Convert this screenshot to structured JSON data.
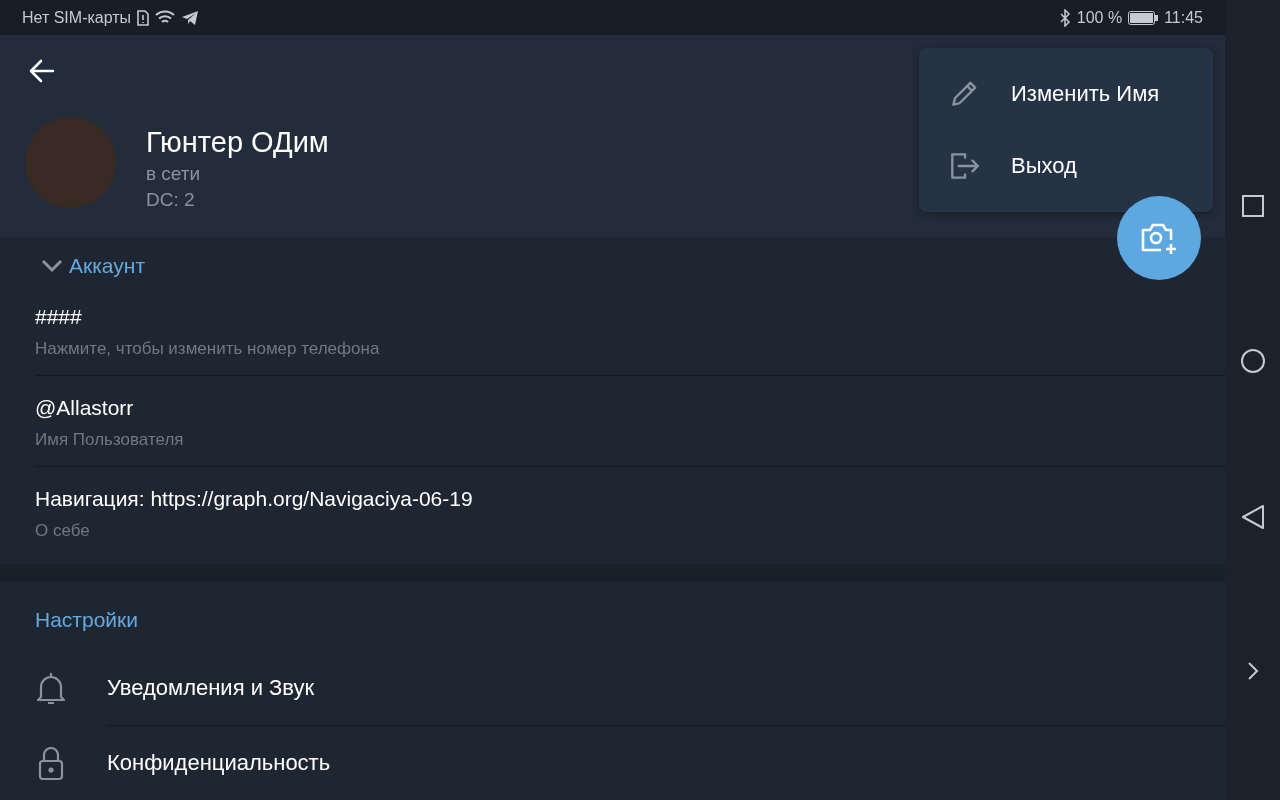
{
  "status_bar": {
    "carrier": "Нет SIM-карты",
    "battery": "100 %",
    "time": "11:45"
  },
  "profile": {
    "name": "Гюнтер ОДим",
    "status": "в сети",
    "dc": "DC: 2"
  },
  "menu": [
    {
      "kind": "edit",
      "label": "Изменить Имя"
    },
    {
      "kind": "logout",
      "label": "Выход"
    }
  ],
  "account": {
    "title": "Аккаунт",
    "rows": [
      {
        "value": "####",
        "label": "Нажмите, чтобы изменить номер телефона"
      },
      {
        "value": "@Allastorr",
        "label": "Имя Пользователя"
      },
      {
        "value": "Навигация: https://graph.org/Navigaciya-06-19",
        "label": "О себе"
      }
    ]
  },
  "settings": {
    "title": "Настройки",
    "items": [
      {
        "kind": "bell",
        "label": "Уведомления и Звук"
      },
      {
        "kind": "lock",
        "label": "Конфиденциальность"
      }
    ]
  }
}
